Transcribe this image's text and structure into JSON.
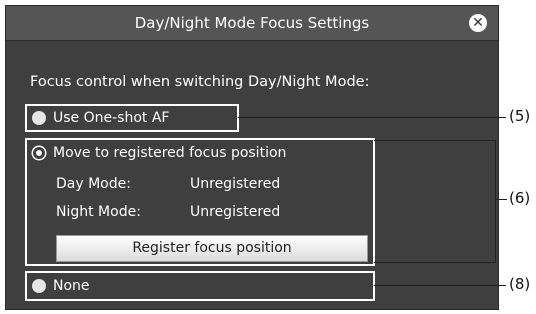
{
  "dialog": {
    "title": "Day/Night Mode Focus Settings",
    "close_glyph": "✕"
  },
  "heading": "Focus control when switching Day/Night Mode:",
  "options": {
    "one_shot": {
      "label": "Use One-shot AF",
      "selected": false
    },
    "registered": {
      "label": "Move to registered focus position",
      "selected": true
    },
    "none": {
      "label": "None",
      "selected": false
    }
  },
  "status": {
    "day_label": "Day Mode:",
    "day_value": "Unregistered",
    "night_label": "Night Mode:",
    "night_value": "Unregistered"
  },
  "register_button": "Register focus position",
  "callouts": {
    "one_shot": "(5)",
    "registered": "(6)",
    "none": "(8)"
  }
}
